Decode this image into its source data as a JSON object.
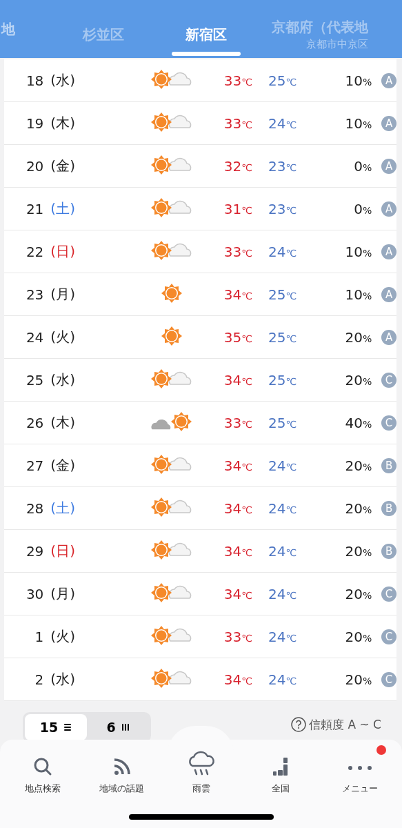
{
  "tabs": [
    {
      "label": "地",
      "selected": false
    },
    {
      "label": "杉並区",
      "selected": false
    },
    {
      "label": "新宿区",
      "selected": true
    },
    {
      "label": "京都府（代表地",
      "sublabel": "京都市中京区",
      "selected": false
    }
  ],
  "days": [
    {
      "date": "18",
      "weekday": "(水)",
      "color": "#222222",
      "kind": "sun_cloud",
      "high": "33",
      "low": "25",
      "unit": "℃",
      "pop": "10",
      "pop_unit": "%",
      "grade": "A"
    },
    {
      "date": "19",
      "weekday": "(木)",
      "color": "#222222",
      "kind": "sun_cloud",
      "high": "33",
      "low": "24",
      "unit": "℃",
      "pop": "10",
      "pop_unit": "%",
      "grade": "A"
    },
    {
      "date": "20",
      "weekday": "(金)",
      "color": "#222222",
      "kind": "sun_cloud",
      "high": "32",
      "low": "23",
      "unit": "℃",
      "pop": "0",
      "pop_unit": "%",
      "grade": "A"
    },
    {
      "date": "21",
      "weekday": "(土)",
      "color": "#3e7be0",
      "kind": "sun_cloud",
      "high": "31",
      "low": "23",
      "unit": "℃",
      "pop": "0",
      "pop_unit": "%",
      "grade": "A"
    },
    {
      "date": "22",
      "weekday": "(日)",
      "color": "#d9262b",
      "kind": "sun_cloud",
      "high": "33",
      "low": "24",
      "unit": "℃",
      "pop": "10",
      "pop_unit": "%",
      "grade": "A"
    },
    {
      "date": "23",
      "weekday": "(月)",
      "color": "#222222",
      "kind": "sun",
      "high": "34",
      "low": "25",
      "unit": "℃",
      "pop": "10",
      "pop_unit": "%",
      "grade": "A"
    },
    {
      "date": "24",
      "weekday": "(火)",
      "color": "#222222",
      "kind": "sun",
      "high": "35",
      "low": "25",
      "unit": "℃",
      "pop": "20",
      "pop_unit": "%",
      "grade": "A"
    },
    {
      "date": "25",
      "weekday": "(水)",
      "color": "#222222",
      "kind": "sun_cloud",
      "high": "34",
      "low": "25",
      "unit": "℃",
      "pop": "20",
      "pop_unit": "%",
      "grade": "C"
    },
    {
      "date": "26",
      "weekday": "(木)",
      "color": "#222222",
      "kind": "cloud_sun",
      "high": "33",
      "low": "25",
      "unit": "℃",
      "pop": "40",
      "pop_unit": "%",
      "grade": "C"
    },
    {
      "date": "27",
      "weekday": "(金)",
      "color": "#222222",
      "kind": "sun_cloud",
      "high": "34",
      "low": "24",
      "unit": "℃",
      "pop": "20",
      "pop_unit": "%",
      "grade": "B"
    },
    {
      "date": "28",
      "weekday": "(土)",
      "color": "#3e7be0",
      "kind": "sun_cloud",
      "high": "34",
      "low": "24",
      "unit": "℃",
      "pop": "20",
      "pop_unit": "%",
      "grade": "B"
    },
    {
      "date": "29",
      "weekday": "(日)",
      "color": "#d9262b",
      "kind": "sun_cloud",
      "high": "34",
      "low": "24",
      "unit": "℃",
      "pop": "20",
      "pop_unit": "%",
      "grade": "B"
    },
    {
      "date": "30",
      "weekday": "(月)",
      "color": "#222222",
      "kind": "sun_cloud",
      "high": "34",
      "low": "24",
      "unit": "℃",
      "pop": "20",
      "pop_unit": "%",
      "grade": "C"
    },
    {
      "date": "1",
      "weekday": "(火)",
      "color": "#222222",
      "kind": "sun_cloud",
      "high": "33",
      "low": "24",
      "unit": "℃",
      "pop": "20",
      "pop_unit": "%",
      "grade": "C"
    },
    {
      "date": "2",
      "weekday": "(水)",
      "color": "#222222",
      "kind": "sun_cloud",
      "high": "34",
      "low": "24",
      "unit": "℃",
      "pop": "20",
      "pop_unit": "%",
      "grade": "C"
    }
  ],
  "range_toggle": [
    {
      "label": "15",
      "kind": "list",
      "selected": true
    },
    {
      "label": "6",
      "kind": "columns",
      "selected": false
    }
  ],
  "reliability": {
    "label": "信頼度 A ~ C"
  },
  "nav": [
    {
      "label": "地点検索",
      "kind": "search",
      "badge": false
    },
    {
      "label": "地域の話題",
      "kind": "feed",
      "badge": false
    },
    {
      "label": "雨雲",
      "kind": "rain",
      "badge": false
    },
    {
      "label": "全国",
      "kind": "map",
      "badge": false
    },
    {
      "label": "メニュー",
      "kind": "menu",
      "badge": true
    }
  ]
}
